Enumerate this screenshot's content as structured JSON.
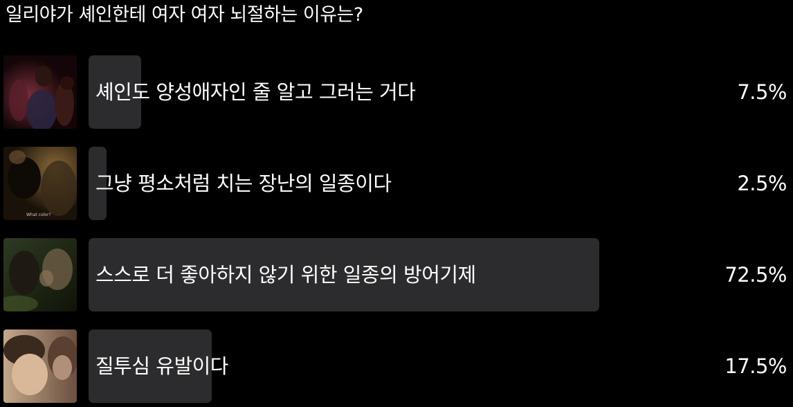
{
  "poll": {
    "question": "일리야가 셰인한테 여자 여자 뇌절하는 이유는?",
    "options": [
      {
        "label": "셰인도 양성애자인 줄 알고 그러는 거다",
        "percent": 7.5,
        "percent_text": "7.5%",
        "thumb_icon": "movie-still-thumbnail"
      },
      {
        "label": "그냥 평소처럼 치는 장난의 일종이다",
        "percent": 2.5,
        "percent_text": "2.5%",
        "thumb_icon": "movie-still-thumbnail",
        "thumb_caption": "What color?"
      },
      {
        "label": "스스로 더 좋아하지 않기 위한 일종의 방어기제",
        "percent": 72.5,
        "percent_text": "72.5%",
        "thumb_icon": "movie-still-thumbnail"
      },
      {
        "label": "질투심 유발이다",
        "percent": 17.5,
        "percent_text": "17.5%",
        "thumb_icon": "movie-still-thumbnail"
      }
    ],
    "colors": {
      "background": "#000000",
      "bar": "#2c2c2e",
      "text": "#ffffff"
    }
  }
}
